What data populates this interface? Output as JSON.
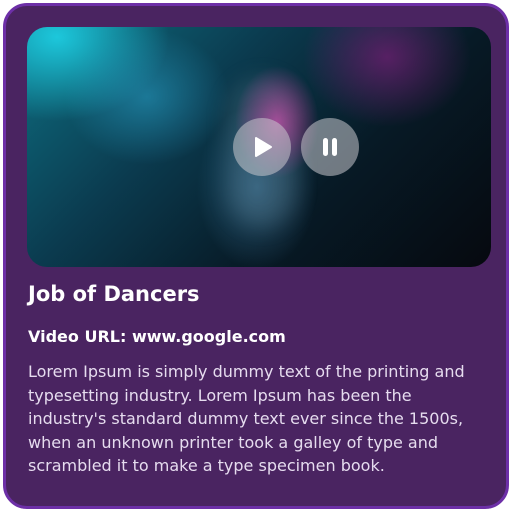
{
  "card": {
    "title": "Job of Dancers",
    "video_url_label": "Video URL:",
    "video_url": "www.google.com",
    "description": "Lorem Ipsum is simply dummy text of the printing and typesetting industry. Lorem Ipsum has been the industry's standard dummy text ever since the 1500s, when an unknown printer took a galley of type and scrambled it to make a type specimen book."
  },
  "video": {
    "controls": [
      {
        "icon": "play-icon"
      },
      {
        "icon": "pause-icon"
      }
    ]
  },
  "colors": {
    "card_background": "#4a2461",
    "card_border": "#6d2fa7",
    "text_primary": "#ffffff",
    "text_secondary": "#e6dcef"
  }
}
